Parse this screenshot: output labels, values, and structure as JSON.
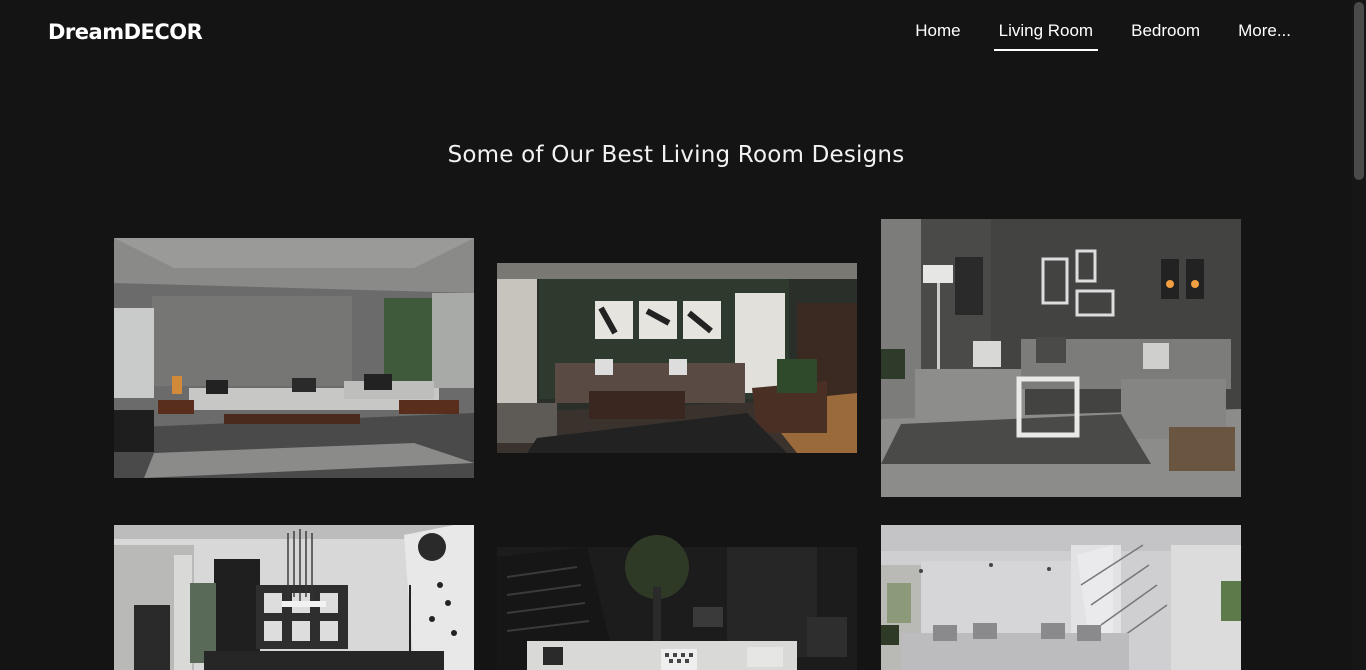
{
  "nav": {
    "brand": "DreamDECOR",
    "items": [
      {
        "label": "Home",
        "active": false
      },
      {
        "label": "Living Room",
        "active": true
      },
      {
        "label": "Bedroom",
        "active": false
      },
      {
        "label": "More...",
        "active": false
      }
    ]
  },
  "page": {
    "heading": "Some of Our Best Living Room Designs"
  },
  "gallery": {
    "photos": [
      {
        "name": "concrete-loft-living-room",
        "icon": "photo-icon"
      },
      {
        "name": "dark-green-wall-living-room",
        "icon": "photo-icon"
      },
      {
        "name": "grey-sectional-living-room",
        "icon": "photo-icon"
      },
      {
        "name": "white-chandelier-living-room",
        "icon": "photo-icon"
      },
      {
        "name": "dark-staircase-living-room",
        "icon": "photo-icon"
      },
      {
        "name": "white-modern-living-room",
        "icon": "photo-icon"
      }
    ]
  },
  "colors": {
    "background": "#141414",
    "text": "#ffffff",
    "active_underline": "#ffffff",
    "scrollbar_thumb": "#4a4a4a"
  }
}
